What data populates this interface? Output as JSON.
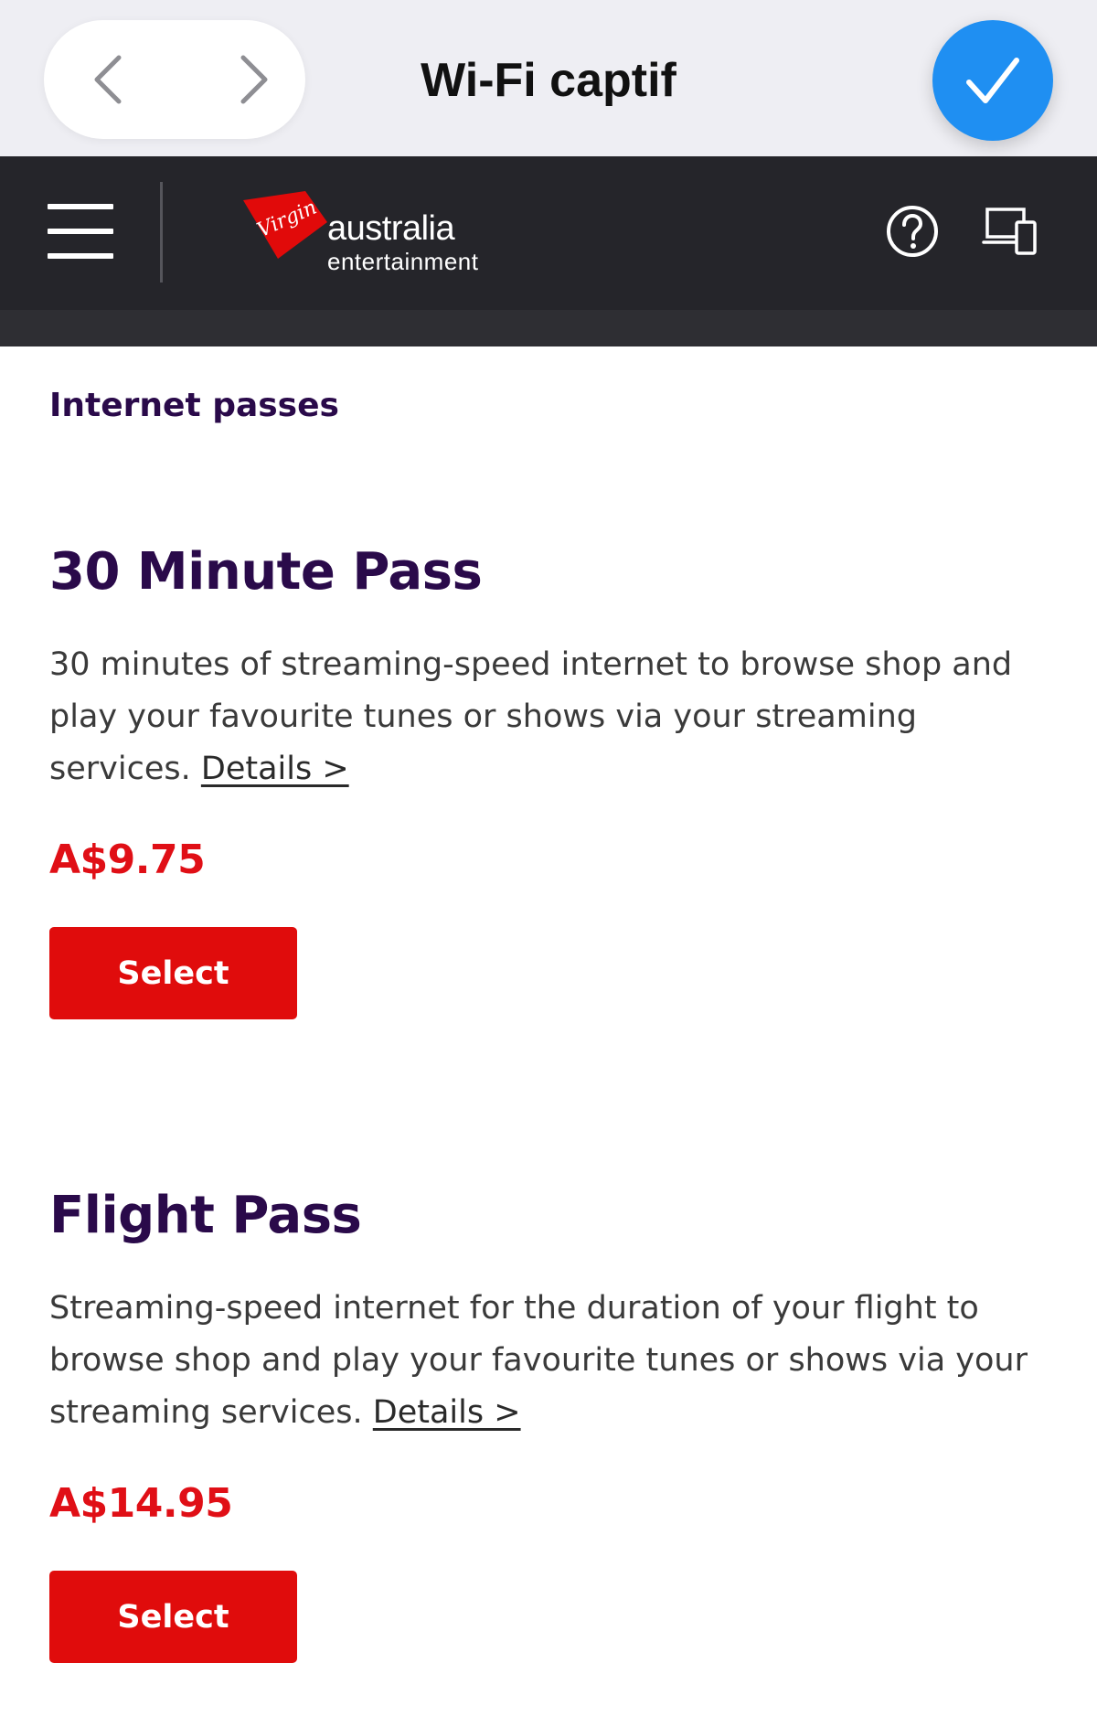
{
  "sheet": {
    "title": "Wi-Fi captif",
    "back_icon": "chevron-left-icon",
    "forward_icon": "chevron-right-icon",
    "done_icon": "checkmark-icon",
    "accent_color": "#1f8ff2"
  },
  "app_bar": {
    "menu_icon": "hamburger-menu-icon",
    "logo": {
      "brand": "Virgin",
      "main": "australia",
      "sub": "entertainment"
    },
    "help_icon": "question-circle-icon",
    "devices_icon": "devices-icon",
    "background_color": "#25252a"
  },
  "main": {
    "section_title": "Internet passes",
    "passes": [
      {
        "name": "30 Minute Pass",
        "description": "30 minutes of streaming-speed internet to browse shop and play your favourite tunes or shows via your streaming services.",
        "details_link": "Details >",
        "price": "A$9.75",
        "button_label": "Select"
      },
      {
        "name": "Flight Pass",
        "description": "Streaming-speed internet for the duration of your flight to browse shop and play your favourite tunes or shows via your streaming services.",
        "details_link": "Details >",
        "price": "A$14.95",
        "button_label": "Select"
      }
    ],
    "title_color": "#2a0a4a",
    "price_color": "#e00f16",
    "button_color": "#e00c0c"
  }
}
